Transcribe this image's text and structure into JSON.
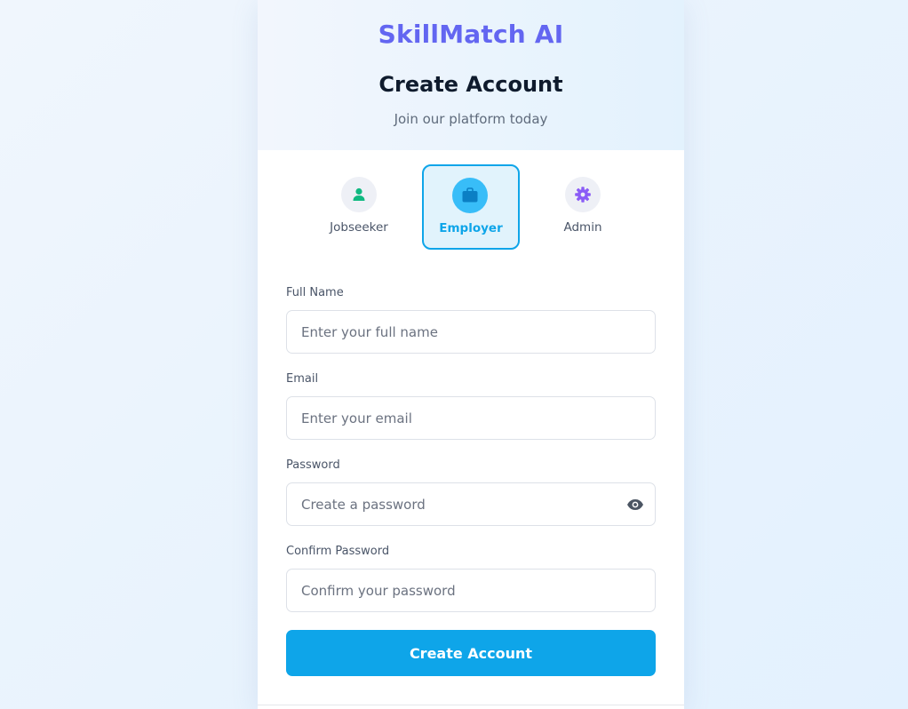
{
  "header": {
    "brand": "SkillMatch AI",
    "title": "Create Account",
    "subtitle": "Join our platform today"
  },
  "roles": [
    {
      "label": "Jobseeker",
      "icon": "user-icon",
      "selected": false
    },
    {
      "label": "Employer",
      "icon": "briefcase-icon",
      "selected": true
    },
    {
      "label": "Admin",
      "icon": "gear-icon",
      "selected": false
    }
  ],
  "form": {
    "full_name": {
      "label": "Full Name",
      "placeholder": "Enter your full name",
      "value": ""
    },
    "email": {
      "label": "Email",
      "placeholder": "Enter your email",
      "value": ""
    },
    "password": {
      "label": "Password",
      "placeholder": "Create a password",
      "value": ""
    },
    "confirm_password": {
      "label": "Confirm Password",
      "placeholder": "Confirm your password",
      "value": ""
    },
    "submit_label": "Create Account"
  },
  "colors": {
    "brand": "#6366f1",
    "accent": "#0ea5e9",
    "jobseeker_icon": "#10b981",
    "admin_icon": "#8b5cf6"
  }
}
